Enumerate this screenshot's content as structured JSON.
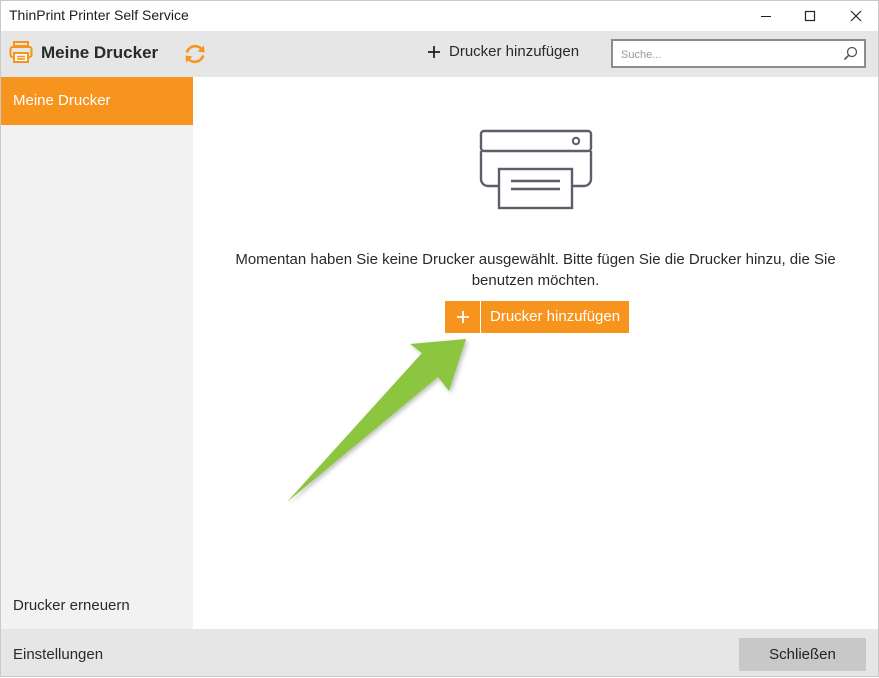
{
  "window": {
    "title": "ThinPrint Printer Self Service",
    "controls": [
      "minimize-icon",
      "maximize-icon",
      "close-icon"
    ]
  },
  "toolbar": {
    "app_title": "Meine Drucker",
    "add_printer_label": "Drucker hinzufügen",
    "search_placeholder": "Suche...",
    "search_value": ""
  },
  "sidebar": {
    "items": [
      {
        "label": "Meine Drucker",
        "active": true
      },
      {
        "label": "Drucker erneuern",
        "active": false
      }
    ]
  },
  "main": {
    "empty_message": "Momentan haben Sie keine Drucker ausgewählt. Bitte fügen Sie die Drucker hinzu, die Sie benutzen möchten.",
    "add_button_label": "Drucker hinzufügen",
    "add_button_icon": "plus-icon"
  },
  "footer": {
    "settings_label": "Einstellungen",
    "close_label": "Schließen"
  },
  "colors": {
    "accent": "#f7941e",
    "annotation_arrow": "#8cc63f"
  }
}
